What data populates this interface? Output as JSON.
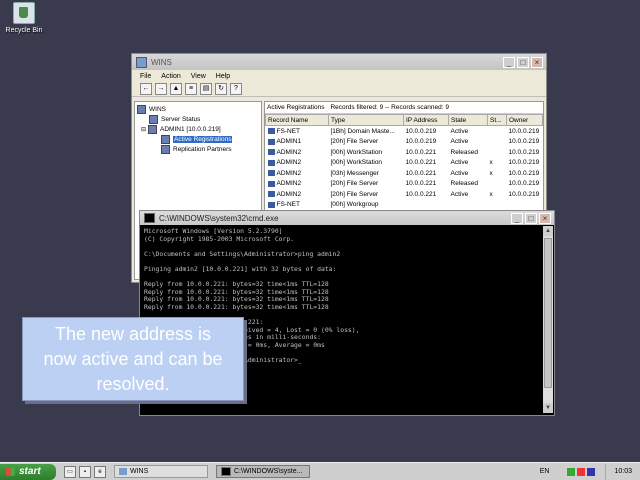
{
  "desktop": {
    "recycle_bin_label": "Recycle Bin"
  },
  "wins": {
    "title": "WINS",
    "menu": [
      "File",
      "Action",
      "View",
      "Help"
    ],
    "toolbar_icons": [
      "back-icon",
      "forward-icon",
      "up-folder-icon",
      "list-view-icon",
      "export-icon",
      "refresh-icon",
      "help-icon"
    ],
    "tree": [
      {
        "label": "WINS",
        "indent": 0,
        "selected": false
      },
      {
        "label": "Server Status",
        "indent": 1,
        "selected": false
      },
      {
        "label": "ADMIN1 [10.0.0.219]",
        "indent": 1,
        "selected": false
      },
      {
        "label": "Active Registrations",
        "indent": 2,
        "selected": true
      },
      {
        "label": "Replication Partners",
        "indent": 2,
        "selected": false
      }
    ],
    "list_title": "Active Registrations",
    "records_filtered": "Records filtered: 9 -- Records scanned: 9",
    "columns": [
      "Record Name",
      "Type",
      "IP Address",
      "State",
      "St...",
      "Owner"
    ],
    "rows": [
      [
        "FS-NET",
        "[1Bh] Domain Maste...",
        "10.0.0.219",
        "Active",
        "",
        "10.0.0.219"
      ],
      [
        "ADMIN1",
        "[20h] File Server",
        "10.0.0.219",
        "Active",
        "",
        "10.0.0.219"
      ],
      [
        "ADMIN2",
        "[00h] WorkStation",
        "10.0.0.221",
        "Released",
        "",
        "10.0.0.219"
      ],
      [
        "ADMIN2",
        "[00h] WorkStation",
        "10.0.0.221",
        "Active",
        "x",
        "10.0.0.219"
      ],
      [
        "ADMIN2",
        "[03h] Messenger",
        "10.0.0.221",
        "Active",
        "x",
        "10.0.0.219"
      ],
      [
        "ADMIN2",
        "[20h] File Server",
        "10.0.0.221",
        "Released",
        "",
        "10.0.0.219"
      ],
      [
        "ADMIN2",
        "[20h] File Server",
        "10.0.0.221",
        "Active",
        "x",
        "10.0.0.219"
      ],
      [
        "FS-NET",
        "[00h] Workgroup",
        "",
        "",
        "",
        ""
      ]
    ]
  },
  "cmd": {
    "title": "C:\\WINDOWS\\system32\\cmd.exe",
    "lines": [
      "Microsoft Windows [Version 5.2.3790]",
      "(C) Copyright 1985-2003 Microsoft Corp.",
      "",
      "C:\\Documents and Settings\\Administrator>ping admin2",
      "",
      "Pinging admin2 [10.0.0.221] with 32 bytes of data:",
      "",
      "Reply from 10.0.0.221: bytes=32 time<1ms TTL=128",
      "Reply from 10.0.0.221: bytes=32 time<1ms TTL=128",
      "Reply from 10.0.0.221: bytes=32 time<1ms TTL=128",
      "Reply from 10.0.0.221: bytes=32 time<1ms TTL=128",
      "",
      "Ping statistics for 10.0.0.221:",
      "    Packets: Sent = 4, Received = 4, Lost = 0 (0% loss),",
      "Approximate round trip times in milli-seconds:",
      "    Minimum = 0ms, Maximum = 0ms, Average = 0ms",
      "",
      "C:\\Documents and Settings\\Administrator>_"
    ]
  },
  "callout": {
    "text": "The new address is now active and can be resolved."
  },
  "taskbar": {
    "start_label": "start",
    "tasks": [
      {
        "label": "WINS",
        "active": false
      },
      {
        "label": "C:\\WINDOWS\\syste...",
        "active": true
      }
    ],
    "language": "EN",
    "clock": "10:03"
  }
}
